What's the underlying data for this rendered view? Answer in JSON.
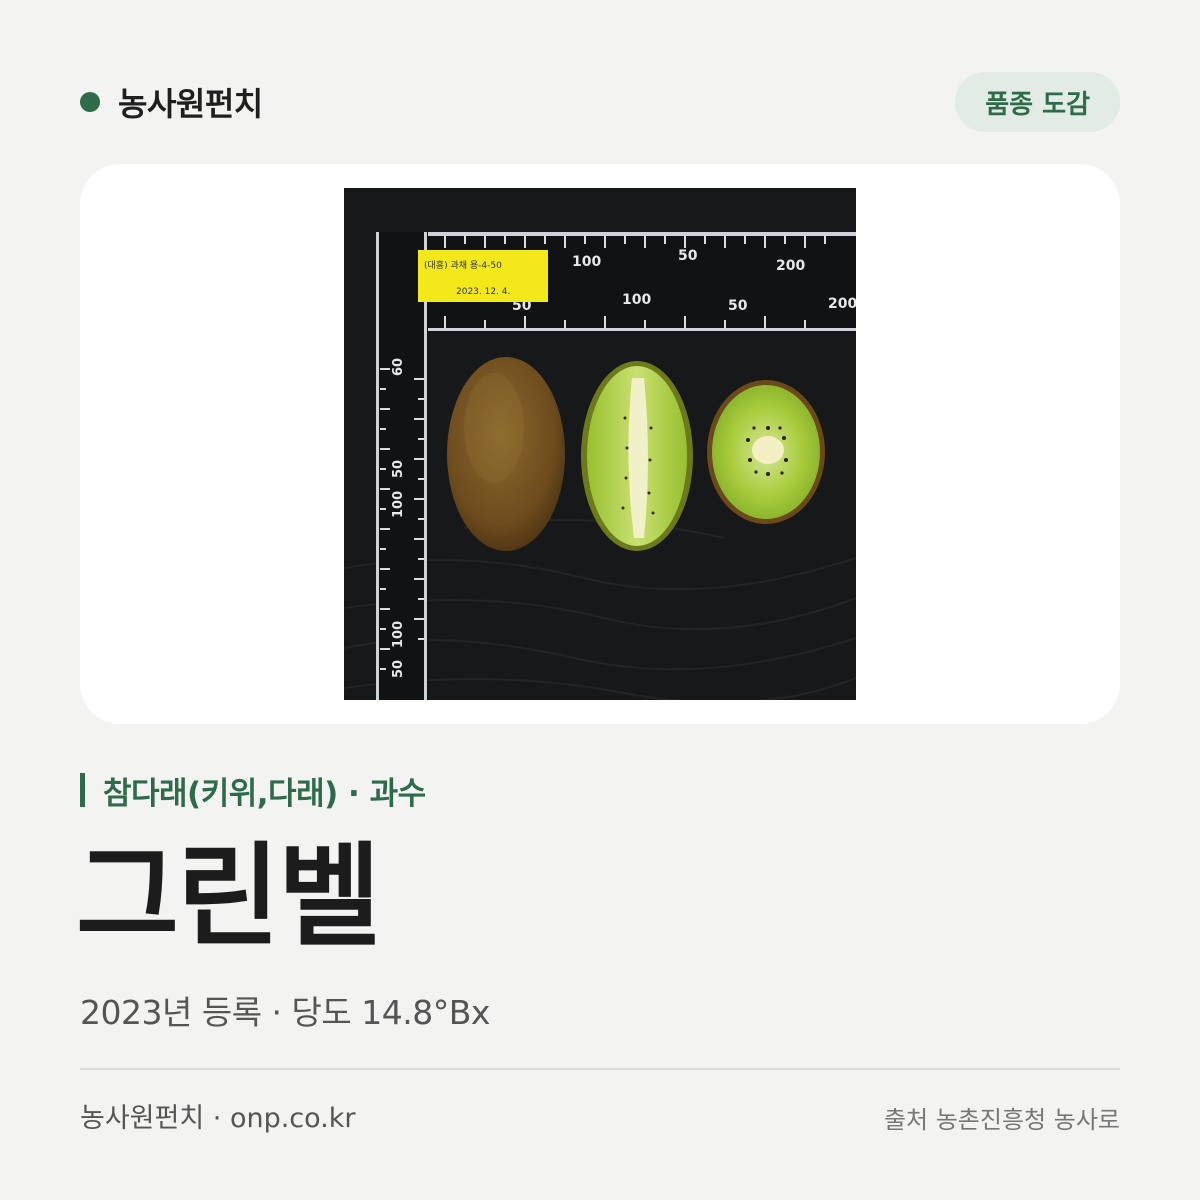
{
  "header": {
    "brand": "농사원펀치",
    "badge": "품종 도감"
  },
  "photo": {
    "label_line1": "(대흥) 과채 용-4-50",
    "label_line2": "2023. 12. 4."
  },
  "crop": {
    "category": "참다래(키위,다래) · 과수",
    "variety_name": "그린벨",
    "meta": "2023년 등록 · 당도 14.8°Bx"
  },
  "footer": {
    "site": "농사원펀치 · onp.co.kr",
    "source": "출처 농촌진흥청 농사로"
  },
  "colors": {
    "accent": "#2e6b4a",
    "background": "#f3f3f1",
    "badge_bg": "#e3ebe5"
  }
}
